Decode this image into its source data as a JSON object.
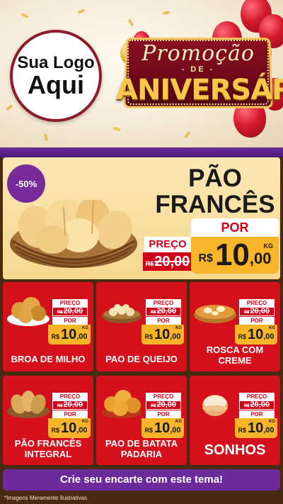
{
  "header": {
    "logo_line1": "Sua Logo",
    "logo_line2": "Aqui",
    "promo_title": "Promoção",
    "promo_de": "- DE -",
    "promo_subtitle": "ANIVERSÁRIO"
  },
  "featured": {
    "discount": "-50%",
    "title": "PÃO FRANCÊS",
    "preco_label": "PREÇO",
    "old_currency": "R$",
    "old_price": "20,00",
    "por_label": "POR",
    "new_currency": "R$",
    "new_price_int": "10",
    "new_price_dec": ",00",
    "unit": "KG"
  },
  "products": [
    {
      "name": "BROA DE MILHO",
      "preco_label": "PREÇO",
      "old_currency": "R$",
      "old_price": "20,00",
      "por_label": "POR",
      "currency": "R$",
      "price_int": "10",
      "price_dec": ",00",
      "unit": "KG"
    },
    {
      "name": "PAO DE QUEIJO",
      "preco_label": "PREÇO",
      "old_currency": "R$",
      "old_price": "20,00",
      "por_label": "POR",
      "currency": "R$",
      "price_int": "10",
      "price_dec": ",00",
      "unit": "KG"
    },
    {
      "name": "ROSCA COM CREME",
      "preco_label": "PREÇO",
      "old_currency": "R$",
      "old_price": "20,00",
      "por_label": "POR",
      "currency": "R$",
      "price_int": "10",
      "price_dec": ",00",
      "unit": "KG"
    },
    {
      "name": "PÃO FRANCÊS INTEGRAL",
      "preco_label": "PREÇO",
      "old_currency": "R$",
      "old_price": "20,00",
      "por_label": "POR",
      "currency": "R$",
      "price_int": "10",
      "price_dec": ",00",
      "unit": "KG"
    },
    {
      "name": "PAO DE BATATA PADARIA",
      "preco_label": "PREÇO",
      "old_currency": "R$",
      "old_price": "20,00",
      "por_label": "POR",
      "currency": "R$",
      "price_int": "10",
      "price_dec": ",00",
      "unit": "KG"
    },
    {
      "name": "SONHOS",
      "preco_label": "PREÇO",
      "old_currency": "R$",
      "old_price": "20,00",
      "por_label": "POR",
      "currency": "R$",
      "price_int": "10",
      "price_dec": ",00",
      "unit": "KG"
    }
  ],
  "footer": {
    "cta": "Crie seu encarte com este tema!",
    "disclaimer": "*Imagens Meramente Ilustrativas"
  },
  "colors": {
    "card_red": "#d3101c",
    "price_yellow": "#f9b52a",
    "accent_purple": "#6c2a9a",
    "background_brown": "#4a2a12"
  }
}
